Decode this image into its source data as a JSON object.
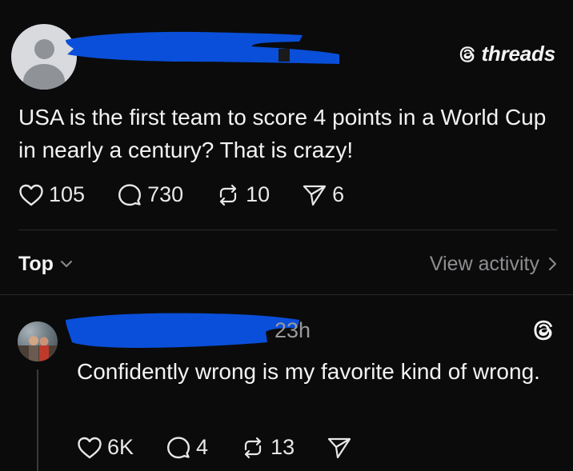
{
  "brand": {
    "name": "threads",
    "icon": "threads-logo-icon"
  },
  "post": {
    "avatar": "default-avatar",
    "text": "USA is the first team to score 4 points in a World Cup in nearly a century? That is crazy!",
    "likes": "105",
    "replies": "730",
    "reposts": "10",
    "shares": "6"
  },
  "sort": {
    "label": "Top",
    "view_activity": "View activity"
  },
  "reply": {
    "time": "23h",
    "text": "Confidently wrong is my favorite kind of wrong.",
    "likes": "6K",
    "replies": "4",
    "reposts": "13"
  },
  "colors": {
    "background": "#0b0b0c",
    "text": "#f3f3f3",
    "muted": "#8d8d90",
    "redaction": "#0a4fd9"
  }
}
